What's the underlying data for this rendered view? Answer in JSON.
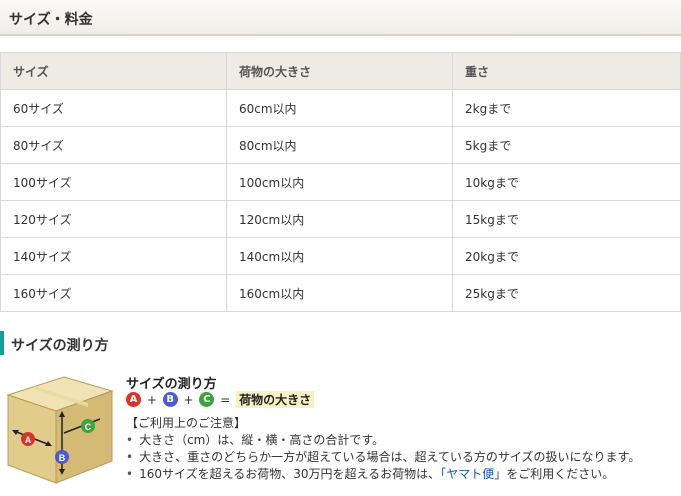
{
  "section": {
    "title": "サイズ・料金"
  },
  "table": {
    "headers": [
      "サイズ",
      "荷物の大きさ",
      "重さ"
    ],
    "rows": [
      [
        "60サイズ",
        "60cm以内",
        "2kgまで"
      ],
      [
        "80サイズ",
        "80cm以内",
        "5kgまで"
      ],
      [
        "100サイズ",
        "100cm以内",
        "10kgまで"
      ],
      [
        "120サイズ",
        "120cm以内",
        "15kgまで"
      ],
      [
        "140サイズ",
        "140cm以内",
        "20kgまで"
      ],
      [
        "160サイズ",
        "160cm以内",
        "25kgまで"
      ]
    ]
  },
  "measure": {
    "heading": "サイズの測り方",
    "title": "サイズの測り方",
    "formula": {
      "a": "A",
      "b": "B",
      "c": "C",
      "plus1": "+",
      "plus2": "+",
      "equals": "=",
      "result": "荷物の大きさ"
    },
    "notice_heading": "【ご利用上のご注意】",
    "notes": [
      "大きさ（cm）は、縦・横・高さの合計です。",
      "大きさ、重さのどちらか一方が超えている場合は、超えている方のサイズの扱いになります。"
    ],
    "note3_prefix": "160サイズを超えるお荷物、30万円を超えるお荷物は、",
    "note3_link": "「ヤマト便」",
    "note3_suffix": "をご利用ください。"
  },
  "colors": {
    "accent": "#0aa39b",
    "circle_a": "#d8342a",
    "circle_b": "#4b5bd6",
    "circle_c": "#3aa53a",
    "box": "#e8d49a",
    "link": "#1a55b0"
  }
}
